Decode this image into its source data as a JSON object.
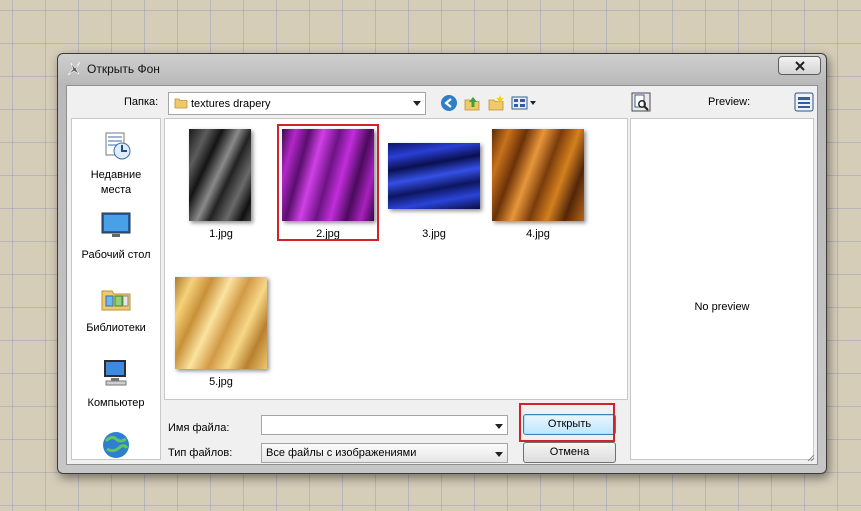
{
  "window": {
    "title": "Открыть Фон"
  },
  "toolbar": {
    "folder_label": "Папка:",
    "folder_value": "textures drapery"
  },
  "places": [
    {
      "label_line1": "Недавние",
      "label_line2": "места",
      "icon": "recent-places-icon"
    },
    {
      "label_line1": "Рабочий стол",
      "label_line2": "",
      "icon": "desktop-icon"
    },
    {
      "label_line1": "Библиотеки",
      "label_line2": "",
      "icon": "libraries-icon"
    },
    {
      "label_line1": "Компьютер",
      "label_line2": "",
      "icon": "computer-icon"
    },
    {
      "label_line1": "",
      "label_line2": "",
      "icon": "network-icon"
    }
  ],
  "files": [
    {
      "name": "1.jpg"
    },
    {
      "name": "2.jpg"
    },
    {
      "name": "3.jpg"
    },
    {
      "name": "4.jpg"
    },
    {
      "name": "5.jpg"
    }
  ],
  "form": {
    "filename_label": "Имя файла:",
    "filename_value": "",
    "filetype_label": "Тип файлов:",
    "filetype_value": "Все файлы с изображениями"
  },
  "buttons": {
    "open": "Открыть",
    "cancel": "Отмена"
  },
  "preview": {
    "label": "Preview:",
    "empty_text": "No preview"
  },
  "colors": {
    "highlight": "#d2232a",
    "default_button": "#bee6fd"
  }
}
